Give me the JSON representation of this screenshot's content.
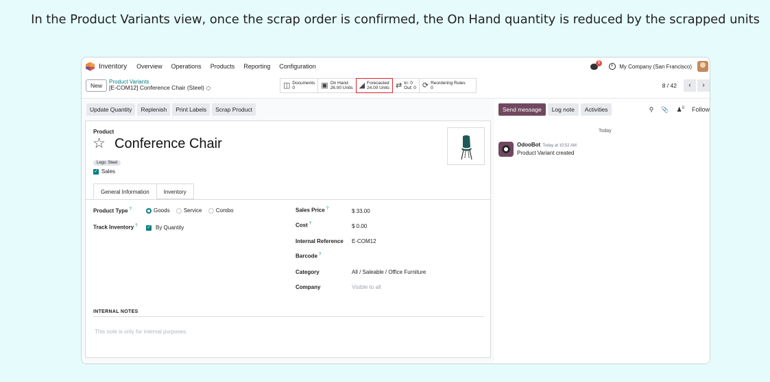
{
  "caption": "In the Product Variants view, once the scrap order is confirmed, the On Hand quantity is reduced by the scrapped units",
  "nav": {
    "app": "Inventory",
    "menu": [
      "Overview",
      "Operations",
      "Products",
      "Reporting",
      "Configuration"
    ],
    "chat_badge": "6",
    "company": "My Company (San Francisco)"
  },
  "control": {
    "new_label": "New",
    "breadcrumb_parent": "Product Variants",
    "breadcrumb_current": "[E-COM12] Conference Chair (Steel)",
    "pager": "8 / 42"
  },
  "smart_buttons": {
    "documents": {
      "label": "Documents",
      "value": "0"
    },
    "on_hand": {
      "label": "On Hand",
      "value": "26.00 Units"
    },
    "forecasted": {
      "label": "Forecasted",
      "value": "24.00 Units"
    },
    "inout": {
      "in": "In: 0",
      "out": "Out: 0"
    },
    "reordering": {
      "label": "Reordering Rules",
      "value": "0"
    }
  },
  "actions": [
    "Update Quantity",
    "Replenish",
    "Print Labels",
    "Scrap Product"
  ],
  "form": {
    "product_label": "Product",
    "name": "Conference Chair",
    "tag": "Legs: Steel",
    "sales_label": "Sales",
    "tabs": [
      "General Information",
      "Inventory"
    ],
    "product_type_label": "Product Type",
    "type_options": [
      "Goods",
      "Service",
      "Combo"
    ],
    "track_inventory_label": "Track Inventory",
    "track_value": "By Quantity",
    "sales_price_label": "Sales Price",
    "sales_price": "$ 33.00",
    "cost_label": "Cost",
    "cost": "$ 0.00",
    "internal_ref_label": "Internal Reference",
    "internal_ref": "E-COM12",
    "barcode_label": "Barcode",
    "category_label": "Category",
    "category": "All / Saleable / Office Furniture",
    "company_label": "Company",
    "company_placeholder": "Visible to all",
    "notes_heading": "INTERNAL NOTES",
    "notes_placeholder": "This note is only for internal purposes."
  },
  "chatter": {
    "send": "Send message",
    "log": "Log note",
    "activities": "Activities",
    "follow": "Follow",
    "today": "Today",
    "author": "OdooBot",
    "time": "Today at 10:52 AM",
    "message": "Product Variant created"
  },
  "colors": {
    "accent": "#017e84",
    "primary": "#71485f",
    "highlight": "#e0202a"
  }
}
